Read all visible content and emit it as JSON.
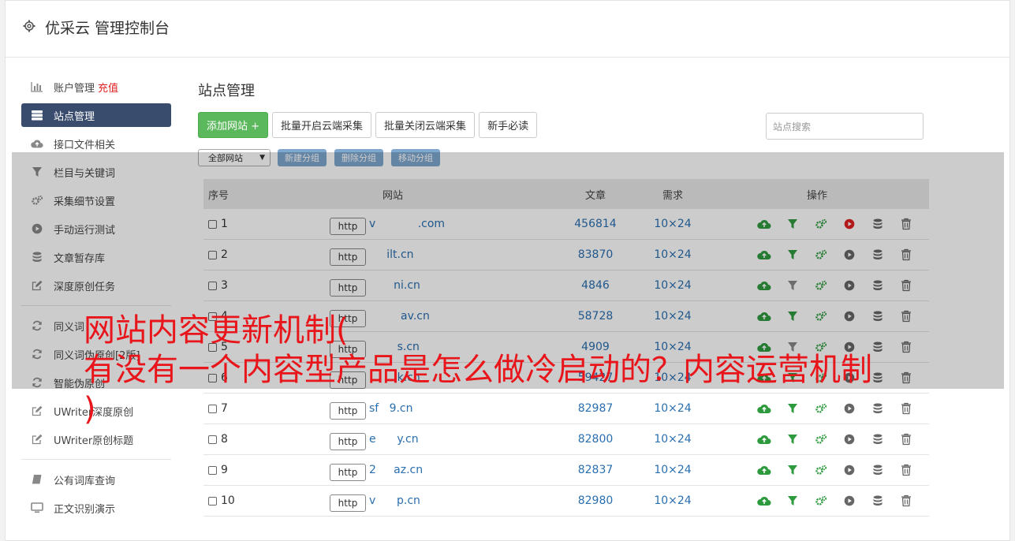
{
  "header": {
    "title": "优采云 管理控制台"
  },
  "sidebar": {
    "items": [
      {
        "label": "账户管理",
        "extra": "充值",
        "icon": "bar-chart-icon"
      },
      {
        "label": "站点管理",
        "icon": "server-icon",
        "active": true
      },
      {
        "label": "接口文件相关",
        "icon": "cloud-upload-icon"
      },
      {
        "label": "栏目与关键词",
        "icon": "filter-icon"
      },
      {
        "label": "采集细节设置",
        "icon": "gears-icon"
      },
      {
        "label": "手动运行测试",
        "icon": "play-icon"
      },
      {
        "label": "文章暂存库",
        "icon": "database-icon"
      },
      {
        "label": "深度原创任务",
        "icon": "edit-icon"
      }
    ],
    "items2": [
      {
        "label": "同义词",
        "icon": "refresh-icon"
      },
      {
        "label": "同义词伪原创[2版]",
        "icon": "refresh-icon"
      },
      {
        "label": "智能伪原创",
        "icon": "refresh-icon"
      },
      {
        "label": "UWriter深度原创",
        "icon": "edit-icon"
      },
      {
        "label": "UWriter原创标题",
        "icon": "edit-icon"
      }
    ],
    "items3": [
      {
        "label": "公有词库查询",
        "icon": "book-icon"
      },
      {
        "label": "正文识别演示",
        "icon": "monitor-icon"
      }
    ]
  },
  "main": {
    "title": "站点管理",
    "toolbar": {
      "add_site": "添加网站 +",
      "batch_open": "批量开启云端采集",
      "batch_close": "批量关闭云端采集",
      "guide": "新手必读"
    },
    "search_placeholder": "站点搜索",
    "group_select": "全部网站",
    "group_buttons": [
      "新建分组",
      "删除分组",
      "移动分组"
    ],
    "columns": {
      "no": "序号",
      "site": "网站",
      "articles": "文章",
      "demand": "需求",
      "ops": "操作"
    },
    "rows": [
      {
        "no": "1",
        "http": "http",
        "url": "v            .com",
        "articles": "456814",
        "demand": "10×24",
        "play_active": true
      },
      {
        "no": "2",
        "http": "http",
        "url": "     ilt.cn",
        "articles": "83870",
        "demand": "10×24"
      },
      {
        "no": "3",
        "http": "http",
        "url": "       ni.cn",
        "articles": "4846",
        "demand": "10×24"
      },
      {
        "no": "4",
        "http": "http",
        "url": "         av.cn",
        "articles": "58728",
        "demand": "10×24"
      },
      {
        "no": "5",
        "http": "http",
        "url": "        s.cn",
        "articles": "4909",
        "demand": "10×24"
      },
      {
        "no": "6",
        "http": "http",
        "url": "        k.cn",
        "articles": "59427",
        "demand": "10×24"
      },
      {
        "no": "7",
        "http": "http",
        "url": "sf   9.cn",
        "articles": "82987",
        "demand": "10×24"
      },
      {
        "no": "8",
        "http": "http",
        "url": "e      y.cn",
        "articles": "82800",
        "demand": "10×24"
      },
      {
        "no": "9",
        "http": "http",
        "url": "2     az.cn",
        "articles": "82837",
        "demand": "10×24"
      },
      {
        "no": "10",
        "http": "http",
        "url": "v      p.cn",
        "articles": "82980",
        "demand": "10×24"
      }
    ]
  },
  "overlay_text": {
    "line1": "网站内容更新机制(",
    "line2": "有没有一个内容型产品是怎么做冷启动的？内容运营机制",
    "line3": ")"
  },
  "colors": {
    "active_nav": "#3a4c6d",
    "add_button": "#5cb85c",
    "link": "#2a6fb0",
    "group_button": "#7fa7cf",
    "headline": "#e8151b"
  }
}
